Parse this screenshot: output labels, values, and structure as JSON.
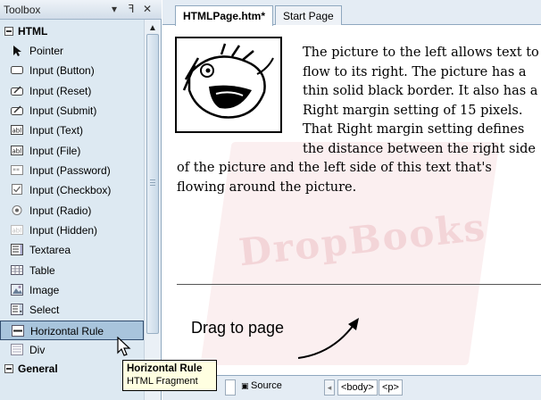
{
  "toolbox": {
    "title": "Toolbox",
    "controls": {
      "dropdown": "▾",
      "pin": "ꟻ",
      "close": "✕"
    },
    "group_html": "HTML",
    "group_general": "General",
    "items": [
      {
        "label": "Pointer",
        "icon": "pointer-arrow-icon"
      },
      {
        "label": "Input (Button)",
        "icon": "button-icon"
      },
      {
        "label": "Input (Reset)",
        "icon": "reset-icon"
      },
      {
        "label": "Input (Submit)",
        "icon": "submit-icon"
      },
      {
        "label": "Input (Text)",
        "icon": "text-field-icon",
        "badge": "abl"
      },
      {
        "label": "Input (File)",
        "icon": "file-field-icon",
        "badge": "abl"
      },
      {
        "label": "Input (Password)",
        "icon": "password-field-icon",
        "badge": "**"
      },
      {
        "label": "Input (Checkbox)",
        "icon": "checkbox-icon"
      },
      {
        "label": "Input (Radio)",
        "icon": "radio-icon"
      },
      {
        "label": "Input (Hidden)",
        "icon": "hidden-field-icon",
        "badge": "abl"
      },
      {
        "label": "Textarea",
        "icon": "textarea-icon"
      },
      {
        "label": "Table",
        "icon": "table-icon"
      },
      {
        "label": "Image",
        "icon": "image-icon"
      },
      {
        "label": "Select",
        "icon": "select-icon"
      },
      {
        "label": "Horizontal Rule",
        "icon": "horizontal-rule-icon",
        "selected": true
      },
      {
        "label": "Div",
        "icon": "div-icon"
      }
    ]
  },
  "tabs": [
    {
      "label": "HTMLPage.htm*",
      "active": true
    },
    {
      "label": "Start Page",
      "active": false
    }
  ],
  "page": {
    "paragraph": "The picture to the left allows text to flow to its right. The picture has a thin solid black border. It also has a Right margin setting of 15 pixels. That Right margin setting defines the distance between the right side of the picture and the left side of this text that's flowing around the picture.",
    "watermark": "DropBooks"
  },
  "annotation": {
    "drag_label": "Drag to page"
  },
  "bottombar": {
    "source_label": "Source",
    "nav_icon": "◂",
    "tags": [
      "<body>",
      "<p>"
    ]
  },
  "tooltip": {
    "title": "Horizontal Rule",
    "subtitle": "HTML Fragment"
  },
  "colors": {
    "panel_bg": "#dde9f2",
    "selection": "#a8c4dc",
    "tooltip_bg": "#ffffe1",
    "watermark": "#f3d5d8"
  }
}
